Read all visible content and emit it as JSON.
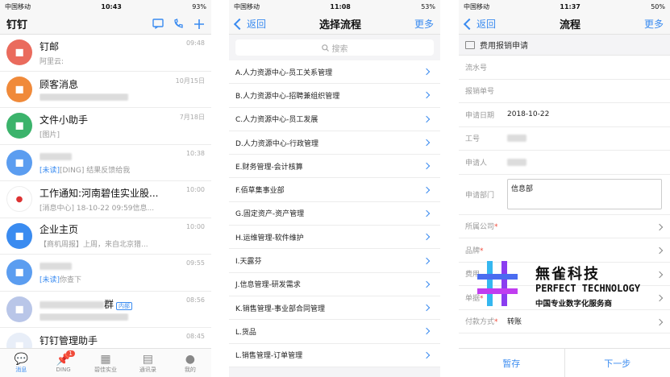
{
  "phone1": {
    "status": {
      "carrier": "中国移动",
      "time": "10:43",
      "battery": "93%"
    },
    "title": "钉钉",
    "chats": [
      {
        "name": "钉邮",
        "preview": "阿里云:",
        "time": "09:48",
        "avatar_color": "#ea6b5d",
        "icon": "mail-icon"
      },
      {
        "name": "顾客消息",
        "preview": "",
        "time": "10月15日",
        "avatar_color": "#f08a3a",
        "icon": "customer-icon"
      },
      {
        "name": "文件小助手",
        "preview": "[图片]",
        "time": "7月18日",
        "avatar_color": "#3bb36b",
        "icon": "folder-icon"
      },
      {
        "name": "",
        "tag": "[未读]",
        "preview": "[DING] 结果反馈给我",
        "time": "10:38",
        "avatar_color": "#5b9df0",
        "icon": "user-icon"
      },
      {
        "name": "工作通知:河南碧佳实业股...",
        "preview": "[消息中心] 18-10-22 09:59信息...",
        "time": "10:00",
        "avatar_color": "#ffffff",
        "icon": "company-logo-icon"
      },
      {
        "name": "企业主页",
        "preview": "【商机周报】上周，来自北京猎...",
        "time": "10:00",
        "avatar_color": "#3a8bf0",
        "icon": "page-icon"
      },
      {
        "name": "",
        "tag": "[未读]",
        "preview": "你查下",
        "time": "09:55",
        "avatar_color": "#5b9df0",
        "icon": "user-icon"
      },
      {
        "name": "群",
        "badge": "内部",
        "preview": "",
        "time": "08:56",
        "avatar_color": "#b9c6e8",
        "icon": "group-icon"
      },
      {
        "name": "钉钉管理助手",
        "preview": "",
        "time": "08:45",
        "avatar_color": "#e8eef8",
        "icon": "admin-avatar"
      }
    ],
    "tabs": [
      {
        "label": "消息",
        "icon": "chat-icon",
        "active": true
      },
      {
        "label": "DING",
        "icon": "ding-icon",
        "badge": "1"
      },
      {
        "label": "碧佳实业",
        "icon": "grid-icon"
      },
      {
        "label": "通讯录",
        "icon": "contacts-icon"
      },
      {
        "label": "我的",
        "icon": "person-icon"
      }
    ]
  },
  "phone2": {
    "status": {
      "carrier": "中国移动",
      "time": "11:08",
      "battery": "53%"
    },
    "back": "返回",
    "title": "选择流程",
    "more": "更多",
    "search_placeholder": "搜索",
    "flows": [
      "A.人力资源中心-员工关系管理",
      "B.人力资源中心-招聘兼组织管理",
      "C.人力资源中心-员工发展",
      "D.人力资源中心-行政管理",
      "E.财务管理-会计核算",
      "F.佰草集事业部",
      "G.固定资产-资产管理",
      "H.运维管理-软件维护",
      "I.天露芬",
      "J.信息管理-研发需求",
      "K.销售管理-事业部合同管理",
      "L.货品",
      "L.销售管理-订单管理"
    ]
  },
  "phone3": {
    "status": {
      "carrier": "中国移动",
      "time": "11:37",
      "battery": "50%"
    },
    "back": "返回",
    "title": "流程",
    "more": "更多",
    "form_title": "费用报销申请",
    "fields": [
      {
        "label": "流水号",
        "value": ""
      },
      {
        "label": "报销单号",
        "value": ""
      },
      {
        "label": "申请日期",
        "value": "2018-10-22"
      },
      {
        "label": "工号",
        "value": ""
      },
      {
        "label": "申请人",
        "value": ""
      },
      {
        "label": "申请部门",
        "value": "信息部"
      },
      {
        "label": "所属公司",
        "required": "*",
        "value": ""
      },
      {
        "label": "品牌",
        "required": "*",
        "value": ""
      },
      {
        "label": "费用",
        "required": "",
        "value": ""
      },
      {
        "label": "单据",
        "required": "*",
        "value": ""
      },
      {
        "label": "付款方式",
        "required": "*",
        "value": "转账"
      }
    ],
    "save": "暂存",
    "next": "下一步"
  },
  "watermark": {
    "name_cn": "無雀科技",
    "name_en": "PERFECT TECHNOLOGY",
    "slogan": "中国专业数字化服务商"
  }
}
